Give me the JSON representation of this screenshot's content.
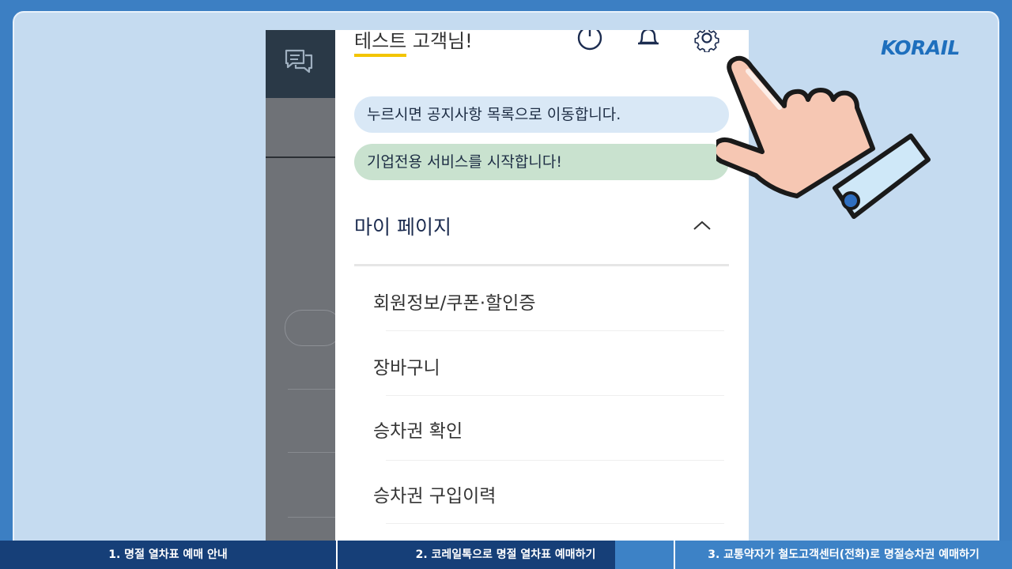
{
  "brand": {
    "logo_text": "KORAIL",
    "color": "#1e6fbd"
  },
  "header": {
    "username": "테스트",
    "greeting_suffix": " 고객님!",
    "icons": [
      "power-icon",
      "bell-icon",
      "gear-icon"
    ]
  },
  "side_panel": {
    "icon": "chat-icon"
  },
  "notices": [
    {
      "text": "누르시면 공지사항 목록으로 이동합니다."
    },
    {
      "text": "기업전용 서비스를 시작합니다!"
    }
  ],
  "my_page": {
    "title": "마이 페이지",
    "items": [
      {
        "label": "회원정보/쿠폰·할인증"
      },
      {
        "label": "장바구니"
      },
      {
        "label": "승차권 확인"
      },
      {
        "label": "승차권 구입이력"
      }
    ]
  },
  "bottom_tabs": [
    {
      "label": "1. 명절 열차표 예매 안내"
    },
    {
      "label": "2. 코레일톡으로 명절 열차표 예매하기"
    },
    {
      "label": "3. 교통약자가 철도고객센터(전화)로 명절승차권 예매하기"
    }
  ],
  "colors": {
    "tab_dark": "#163f78",
    "tab_active": "#3d82c6",
    "background": "#c5dbf0"
  }
}
